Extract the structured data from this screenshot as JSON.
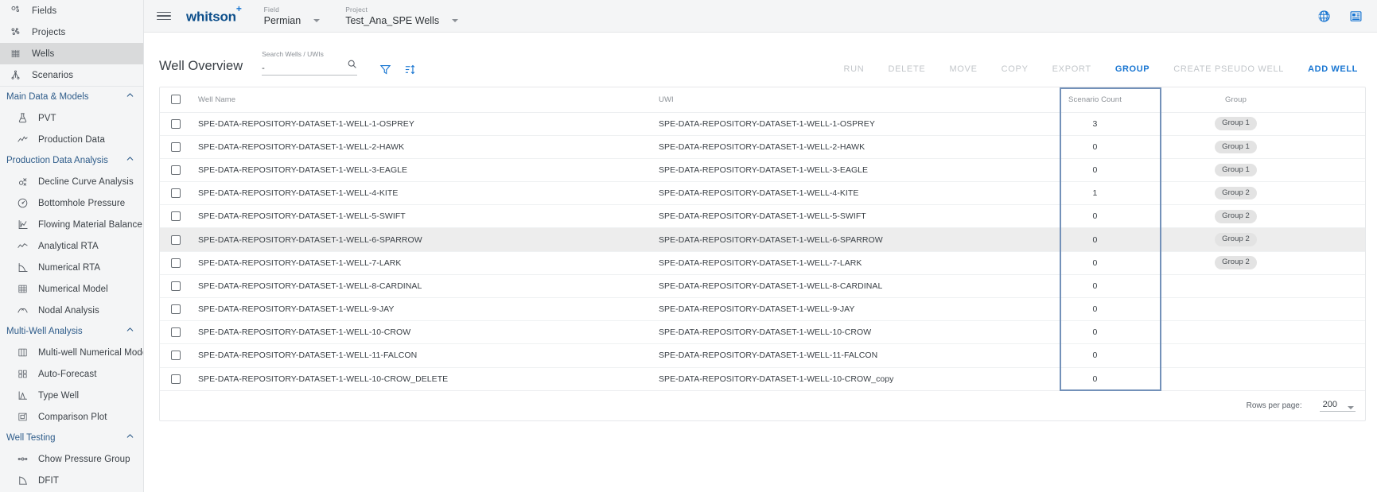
{
  "sidebar": {
    "top_items": [
      {
        "label": "Fields",
        "icon": "fields-icon",
        "active": false
      },
      {
        "label": "Projects",
        "icon": "projects-icon",
        "active": false
      },
      {
        "label": "Wells",
        "icon": "wells-grid-icon",
        "active": true
      },
      {
        "label": "Scenarios",
        "icon": "scenarios-tree-icon",
        "active": false
      }
    ],
    "groups": [
      {
        "label": "Main Data & Models",
        "items": [
          {
            "label": "PVT",
            "icon": "flask-icon"
          },
          {
            "label": "Production Data",
            "icon": "line-chart-icon"
          }
        ]
      },
      {
        "label": "Production Data Analysis",
        "items": [
          {
            "label": "Decline Curve Analysis",
            "icon": "decline-curve-icon"
          },
          {
            "label": "Bottomhole Pressure",
            "icon": "gauge-icon"
          },
          {
            "label": "Flowing Material Balance",
            "icon": "fmb-chart-icon"
          },
          {
            "label": "Analytical RTA",
            "icon": "wave-icon"
          },
          {
            "label": "Numerical RTA",
            "icon": "decay-curve-icon"
          },
          {
            "label": "Numerical Model",
            "icon": "grid-model-icon"
          },
          {
            "label": "Nodal Analysis",
            "icon": "nodal-cross-icon"
          }
        ]
      },
      {
        "label": "Multi-Well Analysis",
        "items": [
          {
            "label": "Multi-well Numerical Model",
            "icon": "columns-icon"
          },
          {
            "label": "Auto-Forecast",
            "icon": "squares-icon"
          },
          {
            "label": "Type Well",
            "icon": "peak-curve-icon"
          },
          {
            "label": "Comparison Plot",
            "icon": "compare-icon"
          }
        ]
      },
      {
        "label": "Well Testing",
        "items": [
          {
            "label": "Chow Pressure Group",
            "icon": "dots-line-icon"
          },
          {
            "label": "DFIT",
            "icon": "falloff-curve-icon"
          }
        ]
      }
    ]
  },
  "topbar": {
    "menu_icon": "hamburger-icon",
    "brand": "whitson",
    "brand_sup": "+",
    "field": {
      "label": "Field",
      "value": "Permian"
    },
    "project": {
      "label": "Project",
      "value": "Test_Ana_SPE Wells"
    },
    "right_icons": [
      {
        "name": "globe-icon"
      },
      {
        "name": "report-form-icon"
      }
    ]
  },
  "page": {
    "title": "Well Overview",
    "search": {
      "label": "Search Wells / UWIs",
      "value": "-",
      "placeholder": ""
    },
    "filter_icon": "filter-icon",
    "sort_icon": "sort-icon"
  },
  "actions": [
    {
      "label": "RUN",
      "state": "disabled"
    },
    {
      "label": "DELETE",
      "state": "disabled"
    },
    {
      "label": "MOVE",
      "state": "disabled"
    },
    {
      "label": "COPY",
      "state": "disabled"
    },
    {
      "label": "EXPORT",
      "state": "disabled"
    },
    {
      "label": "GROUP",
      "state": "enabled"
    },
    {
      "label": "CREATE PSEUDO WELL",
      "state": "disabled"
    },
    {
      "label": "ADD WELL",
      "state": "enabled"
    }
  ],
  "table": {
    "columns": [
      "Well Name",
      "UWI",
      "Scenario Count",
      "Group"
    ],
    "highlight_color": "#7391b9",
    "rows": [
      {
        "well_name": "SPE-DATA-REPOSITORY-DATASET-1-WELL-1-OSPREY",
        "uwi": "SPE-DATA-REPOSITORY-DATASET-1-WELL-1-OSPREY",
        "scenario_count": "3",
        "group": "Group 1",
        "hovered": false
      },
      {
        "well_name": "SPE-DATA-REPOSITORY-DATASET-1-WELL-2-HAWK",
        "uwi": "SPE-DATA-REPOSITORY-DATASET-1-WELL-2-HAWK",
        "scenario_count": "0",
        "group": "Group 1",
        "hovered": false
      },
      {
        "well_name": "SPE-DATA-REPOSITORY-DATASET-1-WELL-3-EAGLE",
        "uwi": "SPE-DATA-REPOSITORY-DATASET-1-WELL-3-EAGLE",
        "scenario_count": "0",
        "group": "Group 1",
        "hovered": false
      },
      {
        "well_name": "SPE-DATA-REPOSITORY-DATASET-1-WELL-4-KITE",
        "uwi": "SPE-DATA-REPOSITORY-DATASET-1-WELL-4-KITE",
        "scenario_count": "1",
        "group": "Group 2",
        "hovered": false
      },
      {
        "well_name": "SPE-DATA-REPOSITORY-DATASET-1-WELL-5-SWIFT",
        "uwi": "SPE-DATA-REPOSITORY-DATASET-1-WELL-5-SWIFT",
        "scenario_count": "0",
        "group": "Group 2",
        "hovered": false
      },
      {
        "well_name": "SPE-DATA-REPOSITORY-DATASET-1-WELL-6-SPARROW",
        "uwi": "SPE-DATA-REPOSITORY-DATASET-1-WELL-6-SPARROW",
        "scenario_count": "0",
        "group": "Group 2",
        "hovered": true
      },
      {
        "well_name": "SPE-DATA-REPOSITORY-DATASET-1-WELL-7-LARK",
        "uwi": "SPE-DATA-REPOSITORY-DATASET-1-WELL-7-LARK",
        "scenario_count": "0",
        "group": "Group 2",
        "hovered": false
      },
      {
        "well_name": "SPE-DATA-REPOSITORY-DATASET-1-WELL-8-CARDINAL",
        "uwi": "SPE-DATA-REPOSITORY-DATASET-1-WELL-8-CARDINAL",
        "scenario_count": "0",
        "group": "",
        "hovered": false
      },
      {
        "well_name": "SPE-DATA-REPOSITORY-DATASET-1-WELL-9-JAY",
        "uwi": "SPE-DATA-REPOSITORY-DATASET-1-WELL-9-JAY",
        "scenario_count": "0",
        "group": "",
        "hovered": false
      },
      {
        "well_name": "SPE-DATA-REPOSITORY-DATASET-1-WELL-10-CROW",
        "uwi": "SPE-DATA-REPOSITORY-DATASET-1-WELL-10-CROW",
        "scenario_count": "0",
        "group": "",
        "hovered": false
      },
      {
        "well_name": "SPE-DATA-REPOSITORY-DATASET-1-WELL-11-FALCON",
        "uwi": "SPE-DATA-REPOSITORY-DATASET-1-WELL-11-FALCON",
        "scenario_count": "0",
        "group": "",
        "hovered": false
      },
      {
        "well_name": "SPE-DATA-REPOSITORY-DATASET-1-WELL-10-CROW_DELETE",
        "uwi": "SPE-DATA-REPOSITORY-DATASET-1-WELL-10-CROW_copy",
        "scenario_count": "0",
        "group": "",
        "hovered": false
      }
    ]
  },
  "footer": {
    "rows_per_page_label": "Rows per page:",
    "rows_per_page_value": "200"
  }
}
